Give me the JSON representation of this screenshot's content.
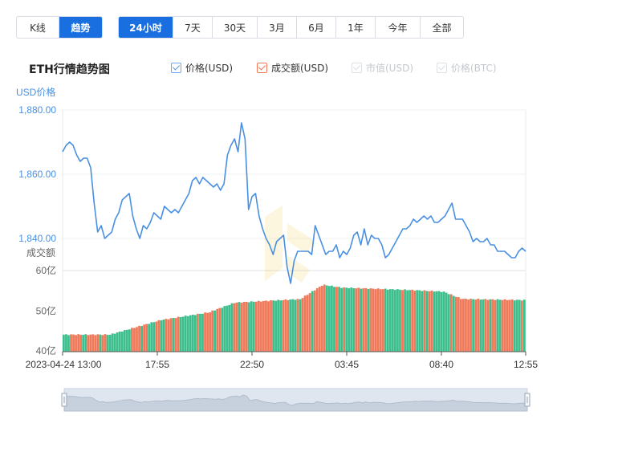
{
  "view_tabs": [
    {
      "label": "K线",
      "active": false
    },
    {
      "label": "趋势",
      "active": true
    }
  ],
  "range_tabs": [
    {
      "label": "24小时",
      "active": true
    },
    {
      "label": "7天",
      "active": false
    },
    {
      "label": "30天",
      "active": false
    },
    {
      "label": "3月",
      "active": false
    },
    {
      "label": "6月",
      "active": false
    },
    {
      "label": "1年",
      "active": false
    },
    {
      "label": "今年",
      "active": false
    },
    {
      "label": "全部",
      "active": false
    }
  ],
  "title": "ETH行情趋势图",
  "legend": [
    {
      "label": "价格(USD)",
      "checked": true,
      "enabled": true,
      "color": "#4a90e2"
    },
    {
      "label": "成交额(USD)",
      "checked": true,
      "enabled": true,
      "color": "#f0795a"
    },
    {
      "label": "市值(USD)",
      "checked": true,
      "enabled": false,
      "color": "#dde0e4"
    },
    {
      "label": "价格(BTC)",
      "checked": true,
      "enabled": false,
      "color": "#dde0e4"
    }
  ],
  "colors": {
    "price_line": "#4a90e2",
    "volume_up": "#3cbf8c",
    "volume_down": "#f0795a",
    "axis_label_price": "#4a90e2"
  },
  "chart_data": {
    "type": "line",
    "price": {
      "ylabel": "USD价格",
      "ylim": [
        1830,
        1880
      ],
      "yticks": [
        "1,880.00",
        "1,860.00",
        "1,840.00"
      ],
      "yticks_values": [
        1880,
        1860,
        1840
      ],
      "values": [
        1867,
        1869,
        1870,
        1869,
        1866,
        1864,
        1865,
        1865,
        1862,
        1851,
        1842,
        1844,
        1840,
        1841,
        1842,
        1846,
        1848,
        1852,
        1853,
        1854,
        1847,
        1843,
        1840,
        1844,
        1843,
        1845,
        1848,
        1847,
        1846,
        1850,
        1849,
        1848,
        1849,
        1848,
        1850,
        1852,
        1854,
        1858,
        1859,
        1857,
        1859,
        1858,
        1857,
        1856,
        1857,
        1855,
        1857,
        1866,
        1869,
        1871,
        1867,
        1876,
        1871,
        1849,
        1853,
        1854,
        1847,
        1843,
        1840,
        1838,
        1835,
        1839,
        1840,
        1841,
        1831,
        1826,
        1833,
        1836,
        1836,
        1836,
        1836,
        1835,
        1844,
        1841,
        1838,
        1835,
        1836,
        1836,
        1838,
        1834,
        1836,
        1835,
        1837,
        1841,
        1842,
        1838,
        1843,
        1838,
        1841,
        1840,
        1840,
        1838,
        1834,
        1835,
        1837,
        1839,
        1841,
        1843,
        1843,
        1844,
        1846,
        1845,
        1846,
        1847,
        1846,
        1847,
        1845,
        1845,
        1846,
        1847,
        1849,
        1851,
        1846,
        1846,
        1846,
        1844,
        1842,
        1839,
        1840,
        1839,
        1839,
        1840,
        1838,
        1838,
        1836,
        1836,
        1836,
        1835,
        1834,
        1834,
        1836,
        1837,
        1836
      ]
    },
    "volume": {
      "ylabel": "成交额",
      "ylim": [
        40,
        60
      ],
      "yticks": [
        "60亿",
        "50亿",
        "40亿"
      ],
      "yticks_values": [
        60,
        50,
        40
      ],
      "unit": "亿"
    },
    "x_ticks": [
      "2023-04-24 13:00",
      "17:55",
      "22:50",
      "03:45",
      "08:40",
      "12:55"
    ],
    "grid": true,
    "navigator": true
  }
}
